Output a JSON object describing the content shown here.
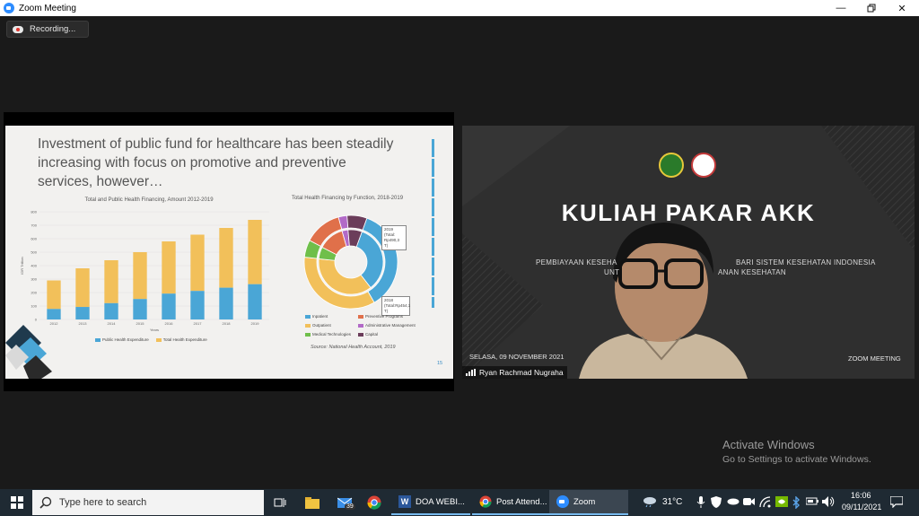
{
  "window": {
    "title": "Zoom Meeting"
  },
  "recording": {
    "label": "Recording..."
  },
  "slide": {
    "title": "Investment of public fund for healthcare has been steadily increasing with focus on promotive and preventive services, however…",
    "bar_chart_title": "Total and Public Health Financing, Amount 2012-2019",
    "donut_chart_title": "Total Health Financing by Function, 2018-2019",
    "source": "Source: National Health Account, 2019",
    "page_number": "15",
    "donut_callout_2019": "2019 (Total: Rp490,3 T)",
    "donut_callout_2018": "2018 (Total:Rp454,1 T)",
    "bar_legend": [
      "Public Health Expenditure",
      "Total Health Expenditure"
    ],
    "donut_legend": [
      "Inpatient",
      "Preventive Programs",
      "Outpatient",
      "Administrative Management",
      "Medical Technologies",
      "Capital"
    ]
  },
  "chart_data": [
    {
      "type": "bar",
      "title": "Total and Public Health Financing, Amount 2012-2019",
      "categories": [
        "2012",
        "2013",
        "2014",
        "2015",
        "2016",
        "2017",
        "2018",
        "2019"
      ],
      "series": [
        {
          "name": "Public Health Expenditure",
          "values": [
            78,
            93,
            121,
            152,
            192,
            212,
            236,
            262
          ]
        },
        {
          "name": "Total Health Expenditure",
          "values": [
            290,
            380,
            440,
            500,
            580,
            630,
            680,
            740
          ]
        }
      ],
      "ylim": [
        0,
        800
      ],
      "yticks": [
        0,
        100,
        200,
        300,
        400,
        500,
        600,
        700,
        800
      ],
      "ylabel": "IDR Trillion",
      "xlabel": "Years",
      "colors": [
        "#4aa6d6",
        "#f2c05a"
      ]
    },
    {
      "type": "pie",
      "title": "Total Health Financing by Function, 2018-2019",
      "rings": [
        {
          "name": "2019",
          "values": [
            36.1,
            35.0,
            6.0,
            13.0,
            3.0,
            6.9
          ]
        },
        {
          "name": "2018",
          "values": [
            34.0,
            37.0,
            6.0,
            13.0,
            3.0,
            7.0
          ]
        }
      ],
      "labels": [
        "Inpatient",
        "Outpatient",
        "Medical Technologies",
        "Preventive Programs",
        "Administrative Management",
        "Capital"
      ],
      "colors": [
        "#4aa6d6",
        "#f2c05a",
        "#6fbf4a",
        "#e0704a",
        "#b26ac7",
        "#6b3d5a"
      ]
    }
  ],
  "speaker": {
    "banner_title": "KULIAH PAKAR AKK",
    "subtitle_line1_a": "PEMBIAYAAN KESEHA",
    "subtitle_line1_b": "BARI SISTEM KESEHATAN INDONESIA",
    "subtitle_line2_a": "UNT",
    "subtitle_line2_b": "ANAN KESEHATAN",
    "date": "SELASA, 09 NOVEMBER 2021",
    "footer_right": "ZOOM MEETING",
    "participant_name": "Ryan Rachmad Nugraha"
  },
  "watermark": {
    "line1": "Activate Windows",
    "line2": "Go to Settings to activate Windows."
  },
  "taskbar": {
    "search_placeholder": "Type here to search",
    "mail_badge": "39",
    "apps": [
      {
        "label": "DOA WEBI..."
      },
      {
        "label": "Post Attend..."
      },
      {
        "label": "Zoom"
      }
    ],
    "temperature": "31°C",
    "time": "16:06",
    "date": "09/11/2021"
  },
  "colors": {
    "zoom_blue": "#2D8CFF",
    "taskbar": "#1f2a33"
  }
}
